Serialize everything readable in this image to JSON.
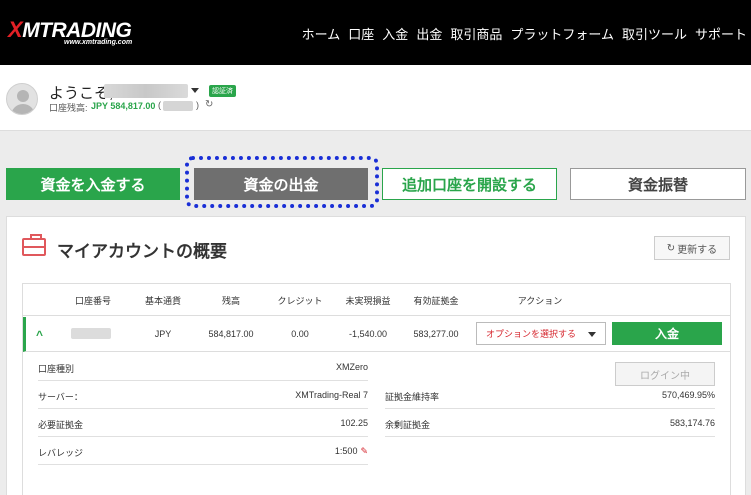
{
  "header": {
    "logo": "XMTRADING",
    "logo_x": "X",
    "logo_rest": "MTRADING",
    "logo_sub": "www.xmtrading.com",
    "nav": [
      "ホーム",
      "口座",
      "入金",
      "出金",
      "取引商品",
      "プラットフォーム",
      "取引ツール",
      "サポート"
    ]
  },
  "user": {
    "greeting": "ようこそ,",
    "verified_badge": "認証済",
    "balance_label": "口座残高:",
    "balance_value": "JPY 584,817.00",
    "balance_paren_open": "(",
    "balance_paren_close": ")"
  },
  "actions": {
    "deposit": "資金を入金する",
    "withdraw": "資金の出金",
    "open_account": "追加口座を開設する",
    "transfer": "資金振替"
  },
  "panel": {
    "title": "マイアカウントの概要",
    "refresh": "更新する"
  },
  "table": {
    "headers": [
      "口座番号",
      "基本通貨",
      "残高",
      "クレジット",
      "未実現損益",
      "有効証拠金",
      "アクション"
    ],
    "row": {
      "currency": "JPY",
      "balance": "584,817.00",
      "credit": "0.00",
      "unrealized": "-1,540.00",
      "equity": "583,277.00",
      "select_label": "オプションを選択する",
      "deposit_button": "入金"
    }
  },
  "details": {
    "account_type_label": "口座種別",
    "account_type_value": "XMZero",
    "server_label": "サーバー：",
    "server_value": "XMTrading-Real 7",
    "required_margin_label": "必要証拠金",
    "required_margin_value": "102.25",
    "leverage_label": "レバレッジ",
    "leverage_value": "1:500",
    "margin_level_label": "証拠金維持率",
    "margin_level_value": "570,469.95%",
    "free_margin_label": "余剰証拠金",
    "free_margin_value": "583,174.76",
    "login_button": "ログイン中"
  },
  "colors": {
    "brand_green": "#2aa54b",
    "brand_red": "#e32026",
    "focus_blue": "#1a2fd6"
  }
}
